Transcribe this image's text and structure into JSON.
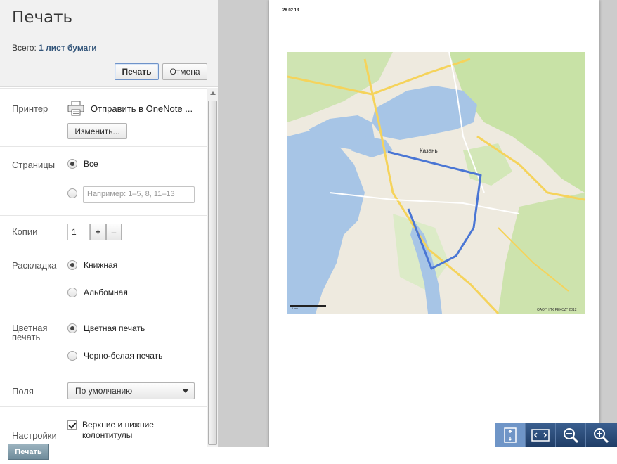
{
  "header": {
    "title": "Печать",
    "summary_prefix": "Всего:",
    "summary_value": "1 лист бумаги",
    "print_label": "Печать",
    "cancel_label": "Отмена"
  },
  "printer": {
    "label": "Принтер",
    "name": "Отправить в OneNote ...",
    "change_label": "Изменить...",
    "icon": "printer-icon"
  },
  "pages": {
    "label": "Страницы",
    "all_label": "Все",
    "all_selected": true,
    "custom_placeholder": "Например: 1–5, 8, 11–13"
  },
  "copies": {
    "label": "Копии",
    "value": "1",
    "plus": "+",
    "minus": "–"
  },
  "layout": {
    "label": "Раскладка",
    "portrait": "Книжная",
    "landscape": "Альбомная",
    "selected": "portrait"
  },
  "color": {
    "label": "Цветная печать",
    "color_option": "Цветная печать",
    "bw_option": "Черно-белая печать",
    "selected": "color"
  },
  "margins": {
    "label": "Поля",
    "value": "По умолчанию"
  },
  "options": {
    "label": "Настройки",
    "headers_footers": "Верхние и нижние колонтитулы",
    "headers_footers_checked": true
  },
  "preview": {
    "date": "28.02.13",
    "map_city": "Казань",
    "map_scale": "1 km",
    "map_copyright": "ОАО \"НПК РЕКОД\" 2012"
  },
  "taskbar": {
    "label": "Печать"
  },
  "zoom_toolbar": {
    "buttons": [
      "fit-page-icon",
      "fit-width-icon",
      "zoom-out-icon",
      "zoom-in-icon"
    ]
  },
  "colors": {
    "accent": "#33557a",
    "map_water": "#a8c6e8",
    "map_park": "#c9e3a9",
    "map_land": "#f2efe6",
    "route": "#4a76d4"
  }
}
